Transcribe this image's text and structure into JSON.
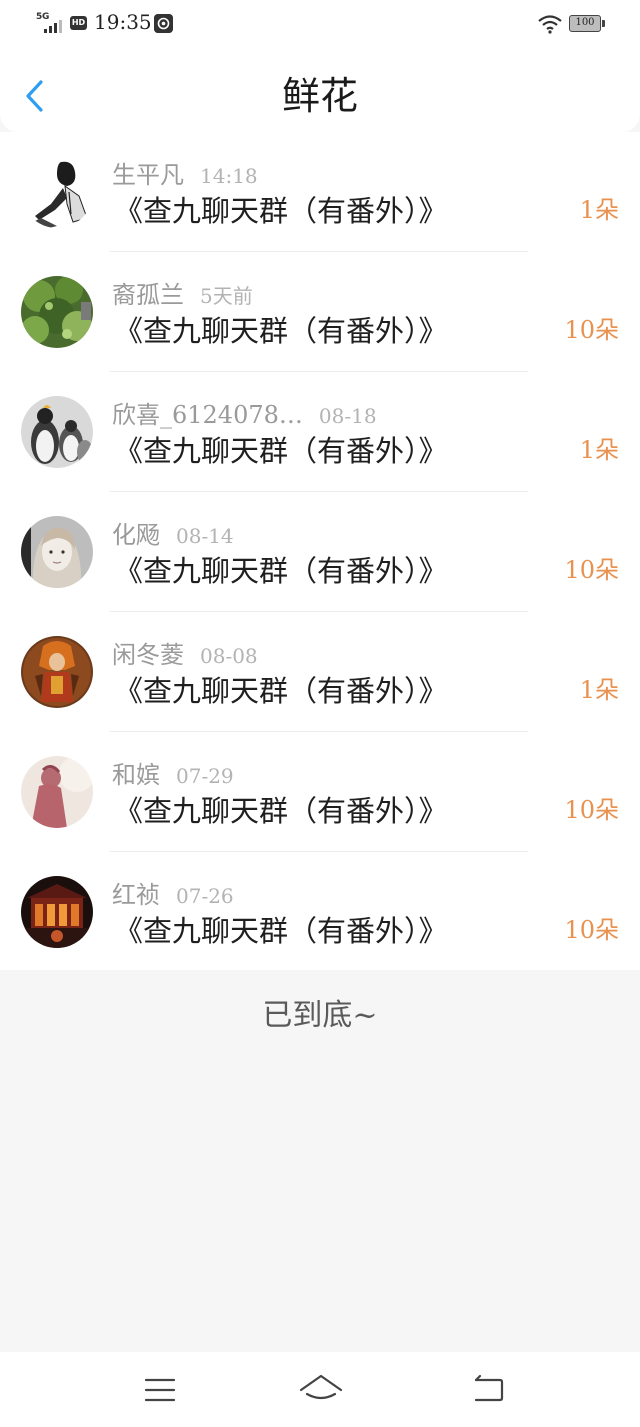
{
  "status_bar": {
    "network": "5G",
    "hd": "HD",
    "time": "19:35",
    "battery": "100"
  },
  "header": {
    "title": "鲜花"
  },
  "items": [
    {
      "name": "生平凡",
      "time": "14:18",
      "title": "《查九聊天群（有番外）》",
      "flowers": "1朵",
      "avatar": "avatar-sketch-figure"
    },
    {
      "name": "裔孤兰",
      "time": "5天前",
      "title": "《查九聊天群（有番外）》",
      "flowers": "10朵",
      "avatar": "avatar-green-plant"
    },
    {
      "name": "欣喜_6124078…",
      "time": "08-18",
      "title": "《查九聊天群（有番外）》",
      "flowers": "1朵",
      "avatar": "avatar-penguins"
    },
    {
      "name": "化飏",
      "time": "08-14",
      "title": "《查九聊天群（有番外）》",
      "flowers": "10朵",
      "avatar": "avatar-girl-portrait"
    },
    {
      "name": "闲冬菱",
      "time": "08-08",
      "title": "《查九聊天群（有番外）》",
      "flowers": "1朵",
      "avatar": "avatar-game-character"
    },
    {
      "name": "和嫔",
      "time": "07-29",
      "title": "《查九聊天群（有番外）》",
      "flowers": "10朵",
      "avatar": "avatar-pink-silhouette"
    },
    {
      "name": "红祯",
      "time": "07-26",
      "title": "《查九聊天群（有番外）》",
      "flowers": "10朵",
      "avatar": "avatar-red-palace"
    }
  ],
  "footer": {
    "end_text": "已到底~"
  },
  "colors": {
    "accent": "#2e9ef0",
    "flower_count": "#e9914e",
    "page_background": "#f7f6f6"
  }
}
